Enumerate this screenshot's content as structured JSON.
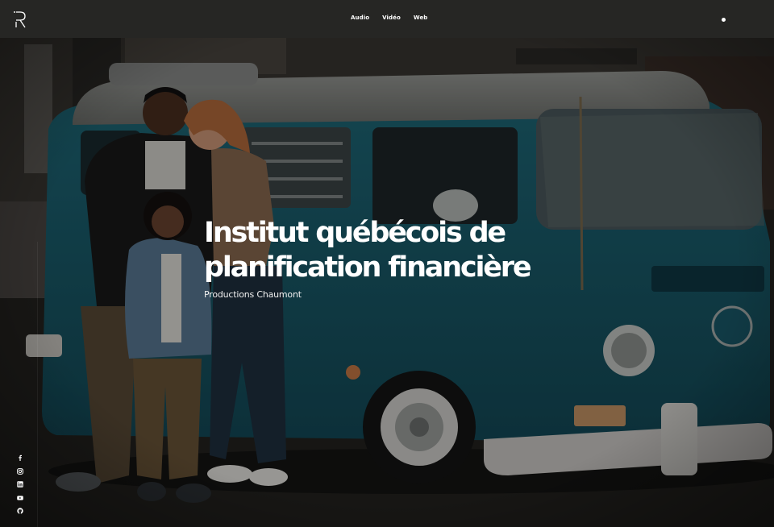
{
  "header": {
    "logo_icon": "R-monogram-logo",
    "nav": [
      {
        "label": "Audio"
      },
      {
        "label": "Vidéo"
      },
      {
        "label": "Web"
      }
    ],
    "menu_icon": "dot-menu-icon"
  },
  "hero": {
    "title": "Institut québécois de planification financière",
    "subtitle": "Productions Chaumont",
    "background": "family-in-front-of-vintage-teal-van"
  },
  "socials": [
    {
      "icon": "facebook-icon"
    },
    {
      "icon": "instagram-icon"
    },
    {
      "icon": "linkedin-icon"
    },
    {
      "icon": "youtube-icon"
    },
    {
      "icon": "github-icon"
    }
  ],
  "colors": {
    "topbar": "#262624",
    "van_teal": "#1b5a6a",
    "text": "#ffffff"
  }
}
